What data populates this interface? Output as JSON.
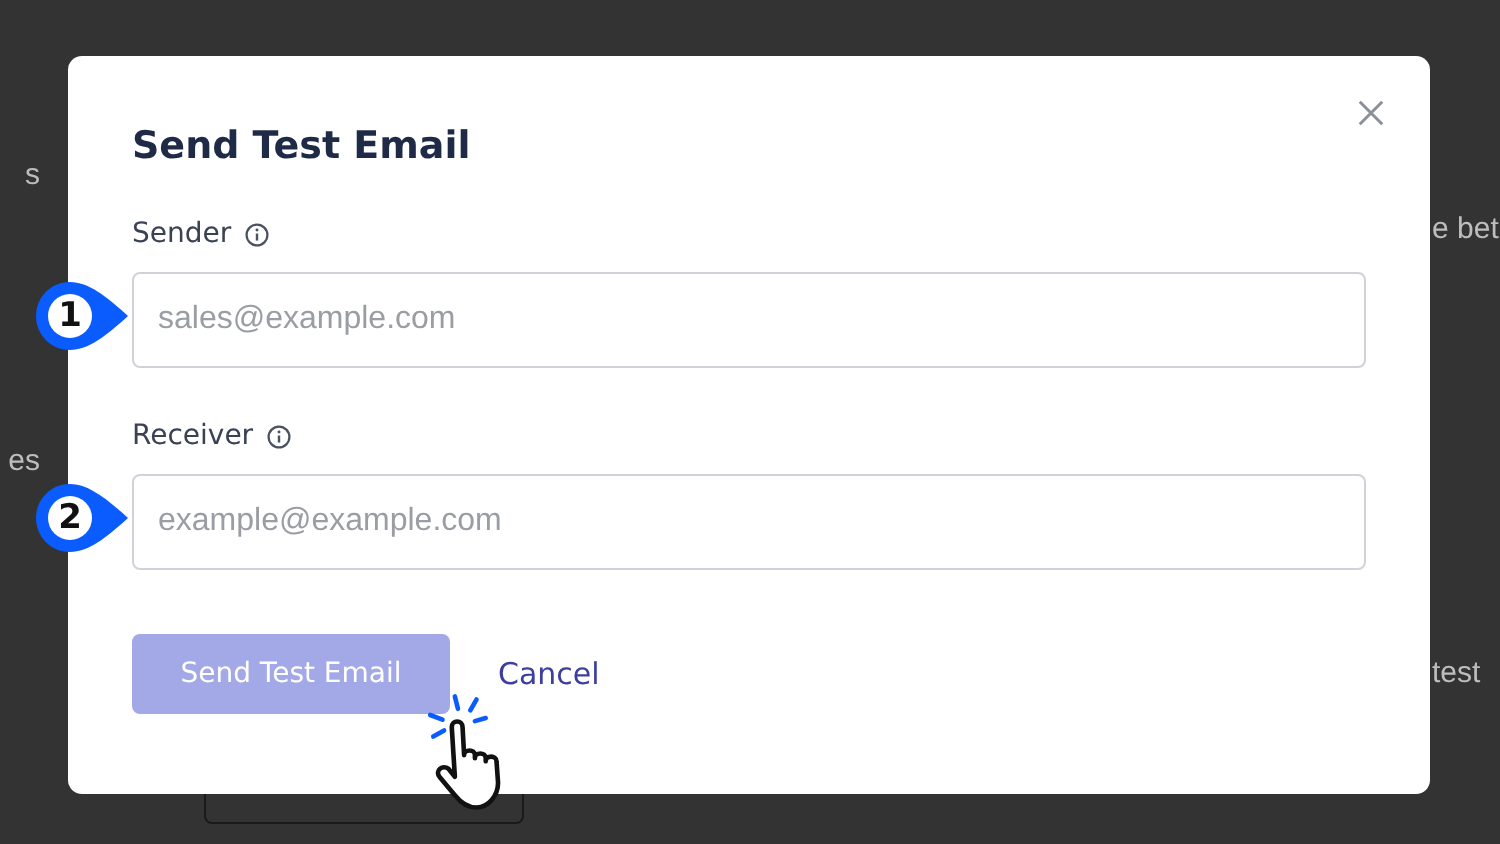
{
  "background": {
    "left_fragments": [
      "s",
      "es"
    ],
    "right_fragments": [
      "e bet",
      "test"
    ]
  },
  "dialog": {
    "title": "Send Test Email",
    "fields": [
      {
        "label": "Sender",
        "placeholder": "sales@example.com",
        "marker": "1"
      },
      {
        "label": "Receiver",
        "placeholder": "example@example.com",
        "marker": "2"
      }
    ],
    "buttons": [
      {
        "kind": "primary",
        "label": "Send Test Email",
        "disabled": true
      },
      {
        "kind": "link",
        "label": "Cancel",
        "disabled": false
      }
    ]
  },
  "cursor": {
    "kind": "click"
  }
}
